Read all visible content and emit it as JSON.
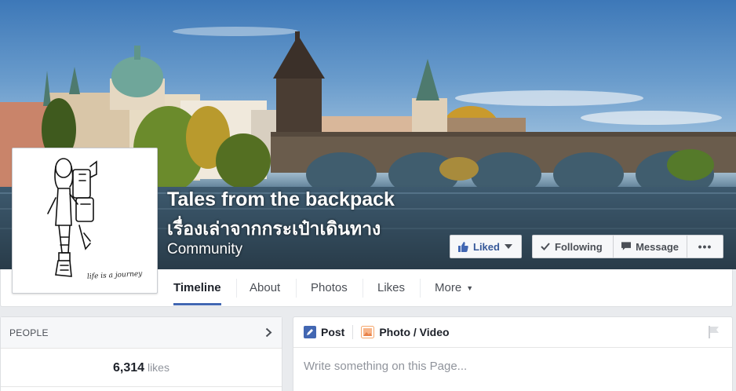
{
  "page": {
    "name": "Tales from the backpack",
    "subname": "เรื่องเล่าจากกระเป๋าเดินทาง",
    "category": "Community",
    "profile_caption": "life is a journey"
  },
  "actions": {
    "liked_label": "Liked",
    "following_label": "Following",
    "message_label": "Message",
    "more_label": "•••"
  },
  "nav": {
    "tabs": [
      {
        "label": "Timeline"
      },
      {
        "label": "About"
      },
      {
        "label": "Photos"
      },
      {
        "label": "Likes"
      },
      {
        "label": "More"
      }
    ],
    "active": "Timeline"
  },
  "people": {
    "title": "PEOPLE",
    "likes_count": "6,314",
    "likes_label": "likes"
  },
  "composer": {
    "post_label": "Post",
    "photo_label": "Photo / Video",
    "placeholder": "Write something on this Page..."
  },
  "colors": {
    "accent": "#4267b2",
    "link": "#365899",
    "background": "#e9ebee"
  }
}
